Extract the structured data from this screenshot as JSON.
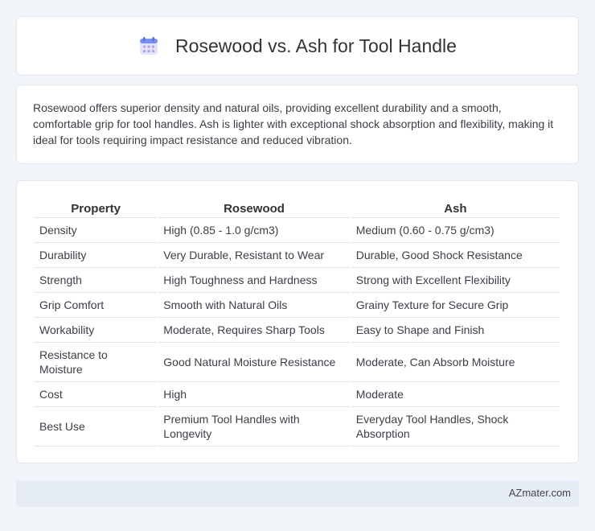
{
  "header": {
    "title": "Rosewood vs. Ash for Tool Handle",
    "icon": "calendar-icon",
    "accent": "#7a8ff0"
  },
  "description": "Rosewood offers superior density and natural oils, providing excellent durability and a smooth, comfortable grip for tool handles. Ash is lighter with exceptional shock absorption and flexibility, making it ideal for tools requiring impact resistance and reduced vibration.",
  "table": {
    "headers": [
      "Property",
      "Rosewood",
      "Ash"
    ],
    "rows": [
      [
        "Density",
        "High (0.85 - 1.0 g/cm3)",
        "Medium (0.60 - 0.75 g/cm3)"
      ],
      [
        "Durability",
        "Very Durable, Resistant to Wear",
        "Durable, Good Shock Resistance"
      ],
      [
        "Strength",
        "High Toughness and Hardness",
        "Strong with Excellent Flexibility"
      ],
      [
        "Grip Comfort",
        "Smooth with Natural Oils",
        "Grainy Texture for Secure Grip"
      ],
      [
        "Workability",
        "Moderate, Requires Sharp Tools",
        "Easy to Shape and Finish"
      ],
      [
        "Resistance to Moisture",
        "Good Natural Moisture Resistance",
        "Moderate, Can Absorb Moisture"
      ],
      [
        "Cost",
        "High",
        "Moderate"
      ],
      [
        "Best Use",
        "Premium Tool Handles with Longevity",
        "Everyday Tool Handles, Shock Absorption"
      ]
    ]
  },
  "footer": {
    "brand": "AZmater.com"
  }
}
